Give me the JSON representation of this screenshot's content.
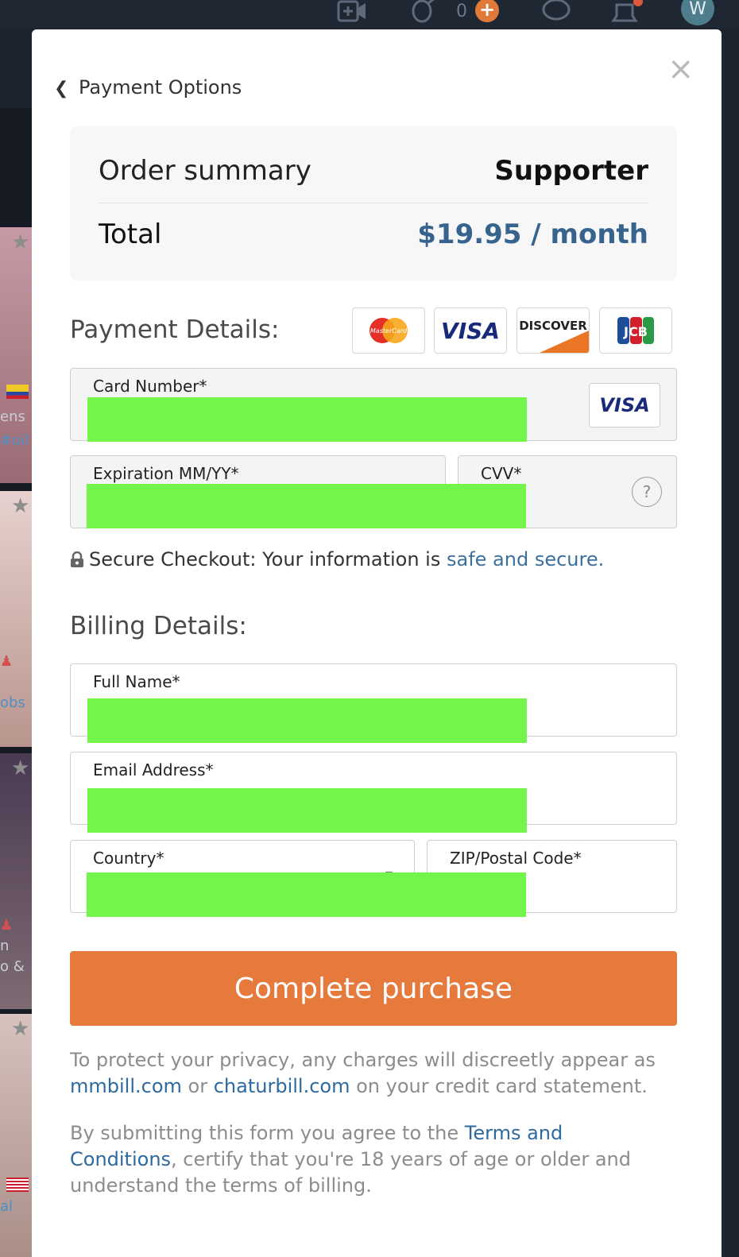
{
  "topbar": {
    "token_count": "0",
    "token_add": "+",
    "avatar_initial": "W"
  },
  "background": {
    "snippets": [
      "ens",
      "#oil",
      "obs",
      "n",
      "o &",
      "al"
    ]
  },
  "modal": {
    "back_label": "Payment Options",
    "close_label": "×"
  },
  "order_summary": {
    "label": "Order summary",
    "plan": "Supporter",
    "total_label": "Total",
    "total_value": "$19.95 / month"
  },
  "payment": {
    "heading": "Payment Details:",
    "card_brands": [
      "MasterCard",
      "VISA",
      "DISCOVER",
      "JCB"
    ],
    "card_number_label": "Card Number*",
    "detected_brand": "VISA",
    "expiration_label": "Expiration MM/YY*",
    "cvv_label": "CVV*",
    "cvv_help": "?"
  },
  "secure": {
    "label": "Secure Checkout:",
    "text": "Your information is",
    "link": "safe and secure."
  },
  "billing": {
    "heading": "Billing Details:",
    "full_name_label": "Full Name*",
    "email_label": "Email Address*",
    "country_label": "Country*",
    "zip_label": "ZIP/Postal Code*"
  },
  "submit_label": "Complete purchase",
  "privacy_note": {
    "before": "To protect your privacy, any charges will discreetly appear as",
    "link1": "mmbill.com",
    "or": "or",
    "link2": "chaturbill.com",
    "after": "on your credit card statement."
  },
  "terms_note": {
    "before": "By submitting this form you agree to the",
    "link": "Terms and Conditions",
    "after": ", certify that you're 18 years of age or older and understand the terms of billing."
  },
  "colors": {
    "accent_orange": "#e57a3c",
    "link_blue": "#3d6f9d",
    "total_blue": "#36648f",
    "redacted_green": "#74f54b"
  }
}
